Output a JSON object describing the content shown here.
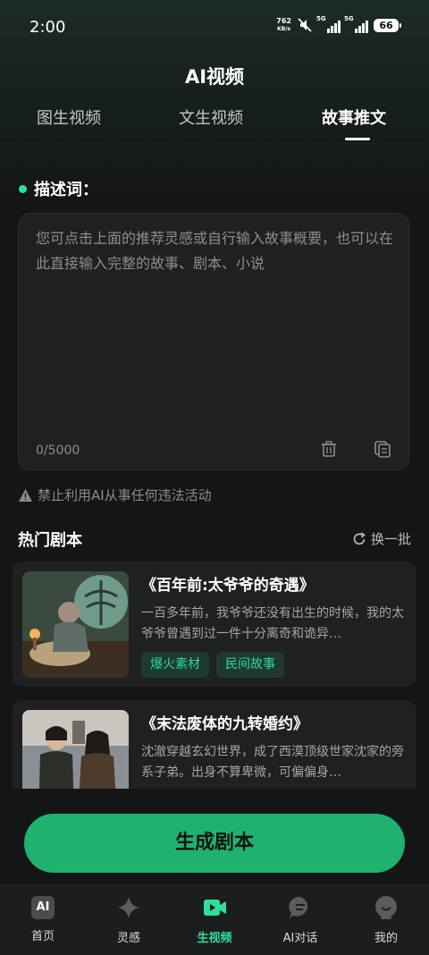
{
  "status_bar": {
    "time": "2:00",
    "net_speed_value": "762",
    "net_speed_unit": "KB/s",
    "signal_1_label": "5G",
    "signal_2_label": "5G",
    "battery": "66"
  },
  "header": {
    "title": "AI视频"
  },
  "tabs": [
    {
      "label": "图生视频"
    },
    {
      "label": "文生视频"
    },
    {
      "label": "故事推文"
    }
  ],
  "active_tab": "故事推文",
  "description": {
    "label": "描述词：",
    "placeholder": "您可点击上面的推荐灵感或自行输入故事概要，也可以在此直接输入完整的故事、剧本、小说",
    "counter": "0/5000"
  },
  "warning": "禁止利用AI从事任何违法活动",
  "hot_scripts": {
    "title": "热门剧本",
    "refresh_label": "换一批",
    "items": [
      {
        "title": "《百年前:太爷爷的奇遇》",
        "desc": "一百多年前，我爷爷还没有出生的时候，我的太爷爷曾遇到过一件十分离奇和诡异…",
        "tags": [
          "爆火素材",
          "民间故事"
        ]
      },
      {
        "title": "《末法废体的九转婚约》",
        "desc": "沈澈穿越玄幻世界，成了西漠顶级世家沈家的旁系子弟。出身不算卑微，可偏偏身…",
        "tags": []
      }
    ]
  },
  "generate_button": "生成剧本",
  "bottom_nav": [
    {
      "label": "首页",
      "icon": "ai-home-icon",
      "icon_text": "AI"
    },
    {
      "label": "灵感",
      "icon": "sparkle-icon"
    },
    {
      "label": "生视频",
      "icon": "video-camera-icon"
    },
    {
      "label": "AI对话",
      "icon": "chat-bubble-icon"
    },
    {
      "label": "我的",
      "icon": "profile-icon"
    }
  ],
  "active_nav": "生视频",
  "colors": {
    "accent": "#2fe099",
    "button": "#1fb26f",
    "background": "#141516",
    "card": "#1e2022",
    "tag_bg": "#1e3a30"
  }
}
